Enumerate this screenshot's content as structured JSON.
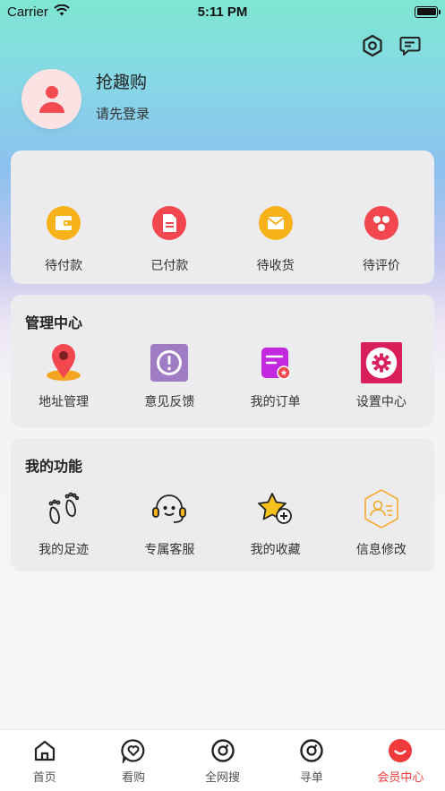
{
  "status_bar": {
    "carrier": "Carrier",
    "time": "5:11 PM"
  },
  "profile": {
    "app_name": "抢趣购",
    "login_hint": "请先登录"
  },
  "orders": {
    "items": [
      {
        "label": "待付款",
        "icon": "wallet-icon",
        "color": "#f7b21a"
      },
      {
        "label": "已付款",
        "icon": "document-icon",
        "color": "#f2474f"
      },
      {
        "label": "待收货",
        "icon": "envelope-icon",
        "color": "#f7b21a"
      },
      {
        "label": "待评价",
        "icon": "share-dots-icon",
        "color": "#f2474f"
      }
    ]
  },
  "manage": {
    "title": "管理中心",
    "items": [
      {
        "label": "地址管理",
        "icon": "location-pin-icon"
      },
      {
        "label": "意见反馈",
        "icon": "feedback-icon"
      },
      {
        "label": "我的订单",
        "icon": "order-icon"
      },
      {
        "label": "设置中心",
        "icon": "settings-gear-icon"
      }
    ]
  },
  "funcs": {
    "title": "我的功能",
    "items": [
      {
        "label": "我的足迹",
        "icon": "footprint-icon"
      },
      {
        "label": "专属客服",
        "icon": "headset-icon"
      },
      {
        "label": "我的收藏",
        "icon": "star-add-icon"
      },
      {
        "label": "信息修改",
        "icon": "user-edit-icon"
      }
    ]
  },
  "tabbar": {
    "tabs": [
      {
        "label": "首页",
        "icon": "home-icon"
      },
      {
        "label": "看购",
        "icon": "heart-chat-icon"
      },
      {
        "label": "全网搜",
        "icon": "search-circle-icon"
      },
      {
        "label": "寻单",
        "icon": "search-circle-icon"
      },
      {
        "label": "会员中心",
        "icon": "smile-icon",
        "active": true
      }
    ]
  },
  "colors": {
    "accent": "#f23a3a",
    "card_bg": "#ececee"
  }
}
